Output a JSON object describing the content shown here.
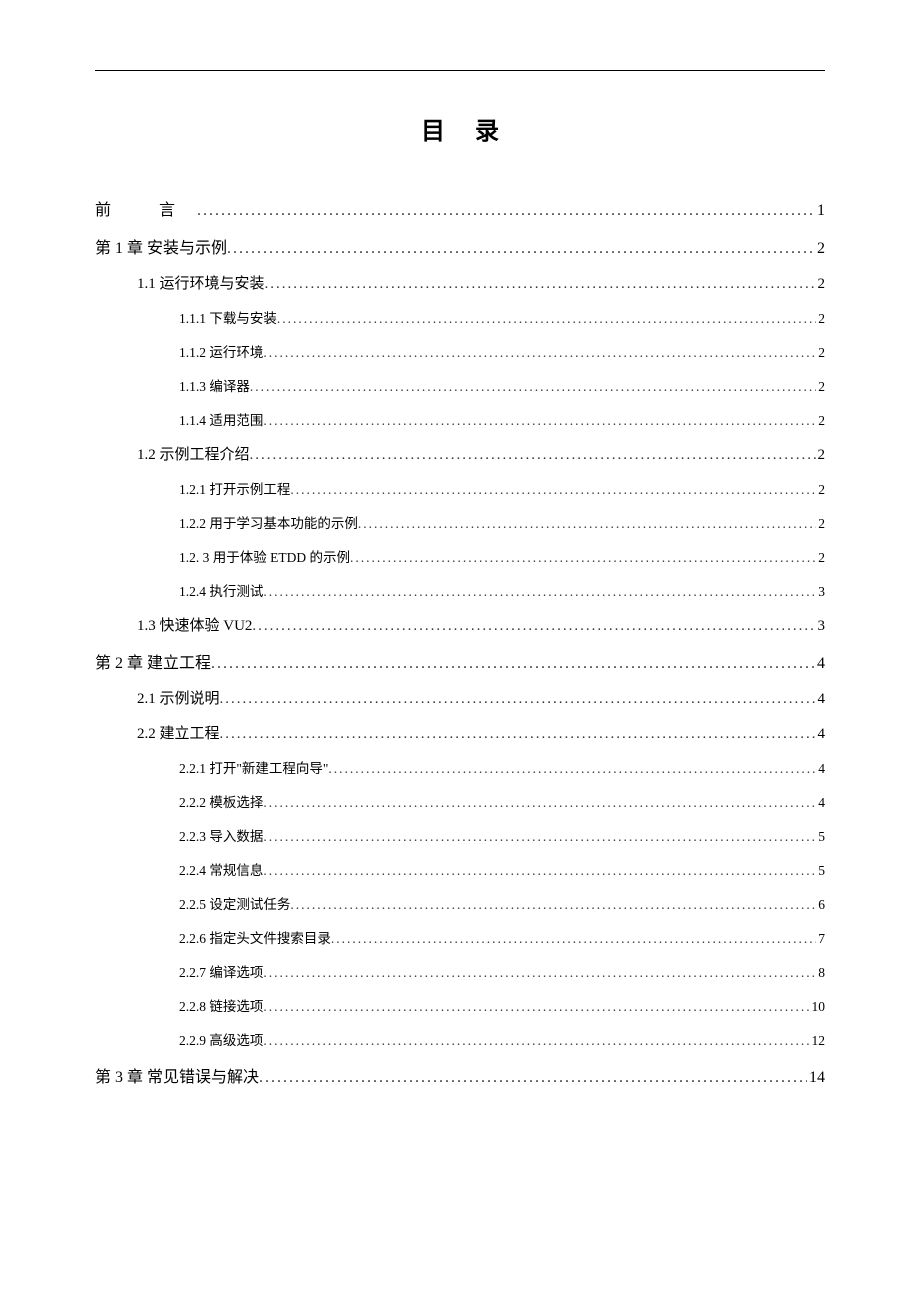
{
  "title": "目录",
  "entries": [
    {
      "level": "level-0",
      "label": "前    言",
      "page": "1",
      "preface": true
    },
    {
      "level": "level-chapter",
      "label": "第 1 章  安装与示例",
      "page": "2"
    },
    {
      "level": "level-1",
      "label": "1.1  运行环境与安装",
      "page": "2"
    },
    {
      "level": "level-2",
      "label": "1.1.1  下载与安装",
      "page": "2"
    },
    {
      "level": "level-2",
      "label": "1.1.2  运行环境",
      "page": "2"
    },
    {
      "level": "level-2",
      "label": "1.1.3  编译器",
      "page": "2"
    },
    {
      "level": "level-2",
      "label": "1.1.4  适用范围",
      "page": "2"
    },
    {
      "level": "level-1",
      "label": "1.2  示例工程介绍",
      "page": "2"
    },
    {
      "level": "level-2",
      "label": "1.2.1 打开示例工程",
      "page": "2"
    },
    {
      "level": "level-2",
      "label": "1.2.2  用于学习基本功能的示例",
      "page": "2"
    },
    {
      "level": "level-2",
      "label": "1.2. 3  用于体验 ETDD 的示例",
      "page": "2"
    },
    {
      "level": "level-2",
      "label": "1.2.4  执行测试",
      "page": "3"
    },
    {
      "level": "level-1",
      "label": "1.3  快速体验 VU2",
      "page": "3"
    },
    {
      "level": "level-chapter",
      "label": "第 2 章  建立工程",
      "page": "4"
    },
    {
      "level": "level-1",
      "label": "2.1  示例说明",
      "page": "4"
    },
    {
      "level": "level-1",
      "label": "2.2  建立工程",
      "page": "4"
    },
    {
      "level": "level-2",
      "label": "2.2.1  打开\"新建工程向导\"",
      "page": "4"
    },
    {
      "level": "level-2",
      "label": "2.2.2  模板选择",
      "page": "4"
    },
    {
      "level": "level-2",
      "label": "2.2.3  导入数据",
      "page": "5"
    },
    {
      "level": "level-2",
      "label": "2.2.4  常规信息",
      "page": "5"
    },
    {
      "level": "level-2",
      "label": "2.2.5  设定测试任务",
      "page": "6"
    },
    {
      "level": "level-2",
      "label": "2.2.6  指定头文件搜索目录",
      "page": "7"
    },
    {
      "level": "level-2",
      "label": "2.2.7  编译选项",
      "page": "8"
    },
    {
      "level": "level-2",
      "label": "2.2.8  链接选项",
      "page": "10"
    },
    {
      "level": "level-2",
      "label": "2.2.9  高级选项",
      "page": "12"
    },
    {
      "level": "level-chapter",
      "label": "第 3 章  常见错误与解决",
      "page": "14"
    }
  ]
}
